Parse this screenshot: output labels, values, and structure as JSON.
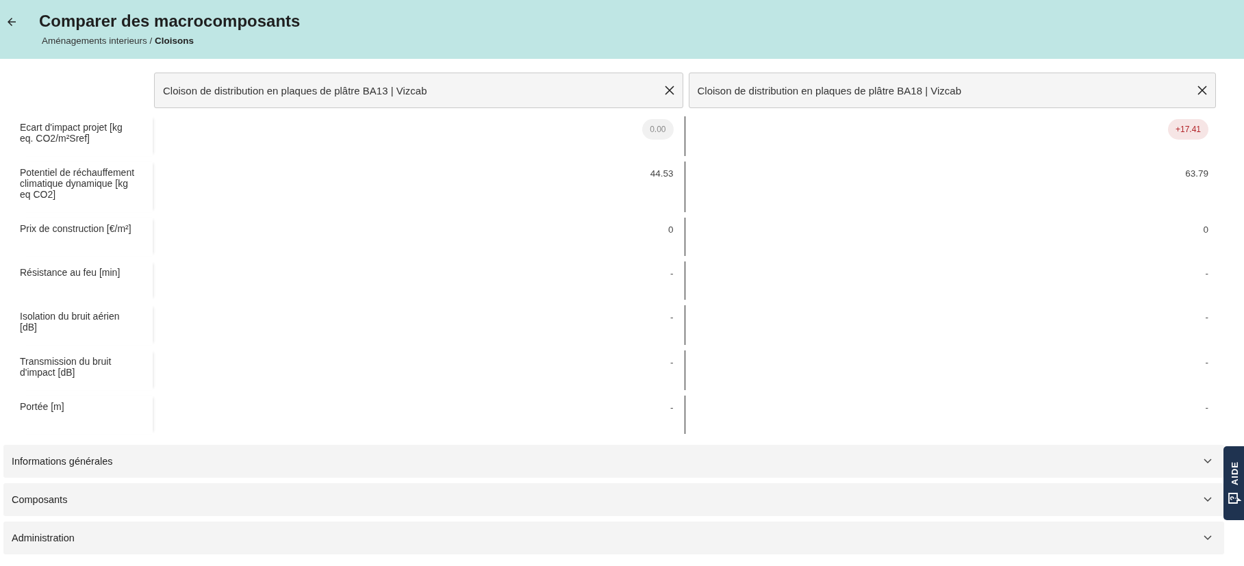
{
  "header": {
    "title": "Comparer des macrocomposants",
    "breadcrumb": {
      "parent": "Aménagements interieurs / ",
      "current": "Cloisons"
    }
  },
  "products": [
    {
      "title": "Cloison de distribution en plaques de plâtre BA13 | Vizcab"
    },
    {
      "title": "Cloison de distribution en plaques de plâtre BA18 | Vizcab"
    }
  ],
  "rows": [
    {
      "label": "Ecart d'impact projet [kg eq. CO2/m²Sref]",
      "kind": "badge",
      "cells": [
        {
          "text": "0.00",
          "color": "#8a8a8a"
        },
        {
          "text": "+17.41",
          "color": "#b3262b"
        }
      ]
    },
    {
      "label": "Potentiel de réchauffement climatique dynamique [kg eq CO2]",
      "kind": "plain",
      "cells": [
        {
          "text": "44.53"
        },
        {
          "text": "63.79"
        }
      ]
    },
    {
      "label": "Prix de construction [€/m²]",
      "kind": "plain",
      "cells": [
        {
          "text": "0"
        },
        {
          "text": "0"
        }
      ]
    },
    {
      "label": "Résistance au feu [min]",
      "kind": "plain",
      "cells": [
        {
          "text": "-"
        },
        {
          "text": "-"
        }
      ]
    },
    {
      "label": "Isolation du bruit aérien [dB]",
      "kind": "plain",
      "cells": [
        {
          "text": "-"
        },
        {
          "text": "-"
        }
      ]
    },
    {
      "label": "Transmission du bruit d'impact [dB]",
      "kind": "plain",
      "cells": [
        {
          "text": "-"
        },
        {
          "text": "-"
        }
      ]
    },
    {
      "label": "Portée [m]",
      "kind": "plain",
      "cells": [
        {
          "text": "-"
        },
        {
          "text": "-"
        }
      ]
    }
  ],
  "sections": [
    {
      "title": "Informations générales",
      "expanded": false
    },
    {
      "title": "Composants",
      "expanded": false
    },
    {
      "title": "Administration",
      "expanded": false
    }
  ],
  "help_tab": {
    "label": "AIDE"
  }
}
